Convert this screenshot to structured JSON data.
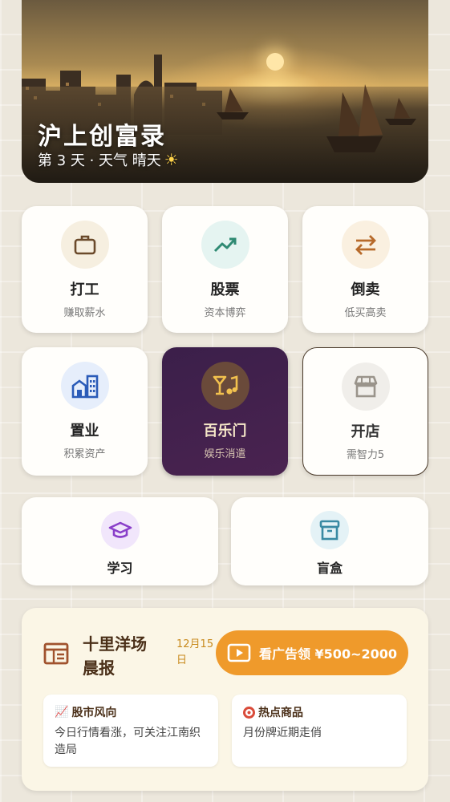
{
  "hero": {
    "title": "沪上创富录",
    "day_text": "第 3 天 · 天气 晴天",
    "weather_icon": "sun-icon"
  },
  "actions": [
    {
      "id": "work",
      "title": "打工",
      "subtitle": "赚取薪水",
      "icon": "briefcase-icon",
      "icon_bg": "#f6efe0",
      "icon_color": "#6b4a2b"
    },
    {
      "id": "stocks",
      "title": "股票",
      "subtitle": "资本博弈",
      "icon": "trending-up-icon",
      "icon_bg": "#e5f4f1",
      "icon_color": "#2f8a73"
    },
    {
      "id": "trade",
      "title": "倒卖",
      "subtitle": "低买高卖",
      "icon": "swap-arrows-icon",
      "icon_bg": "#faf0e0",
      "icon_color": "#b76a2a"
    },
    {
      "id": "property",
      "title": "置业",
      "subtitle": "积累资产",
      "icon": "buildings-icon",
      "icon_bg": "#e6eefb",
      "icon_color": "#2a5bb8"
    },
    {
      "id": "paramount",
      "title": "百乐门",
      "subtitle": "娱乐消遣",
      "icon": "cocktail-music-icon",
      "icon_bg": "#6a4a3a",
      "icon_color": "#f2c14e"
    },
    {
      "id": "shop",
      "title": "开店",
      "subtitle": "需智力5",
      "icon": "storefront-icon",
      "icon_bg": "#f0eeea",
      "icon_color": "#9a948b"
    },
    {
      "id": "study",
      "title": "学习",
      "icon": "graduation-cap-icon",
      "icon_bg": "#f1e6fb",
      "icon_color": "#8a3fc9"
    },
    {
      "id": "blindbox",
      "title": "盲盒",
      "icon": "archive-box-icon",
      "icon_bg": "#e4f2f6",
      "icon_color": "#3a8aa3"
    }
  ],
  "news": {
    "title": "十里洋场晨报",
    "date": "12月15日",
    "ad_button_label": "看广告领 ¥500~2000",
    "tips": [
      {
        "heading": "股市风向",
        "heading_icon": "chart-up-icon",
        "body": "今日行情看涨，可关注江南织造局"
      },
      {
        "heading": "热点商品",
        "heading_icon": "target-icon",
        "body": "月份牌近期走俏"
      }
    ]
  }
}
